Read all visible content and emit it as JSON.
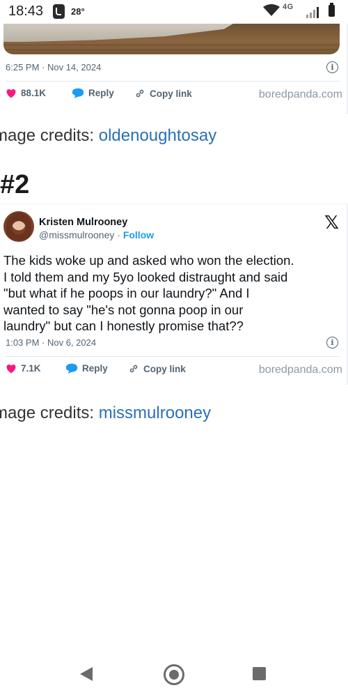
{
  "status_bar": {
    "time": "18:43",
    "temperature": "28°",
    "network": "4G",
    "icons": [
      "phone-call-icon",
      "wifi-icon",
      "cell-signal-icon",
      "battery-icon"
    ]
  },
  "tweet1": {
    "timestamp": "6:25 PM · Nov 14, 2024",
    "likes": "88.1K",
    "reply_label": "Reply",
    "copy_link_label": "Copy link",
    "source": "boredpanda.com"
  },
  "credits1": {
    "prefix": "mage credits: ",
    "link": "oldenoughtosay"
  },
  "item2": {
    "number": "#2"
  },
  "tweet2": {
    "author_name": "Kristen Mulrooney",
    "handle": "@missmulrooney",
    "separator": " · ",
    "follow_label": "Follow",
    "lines": [
      "The kids woke up and asked who won the election.",
      "I told them and my 5yo looked distraught and said",
      "\"but what if he poops in our laundry?\" And I",
      "wanted to say \"he's not gonna poop in our",
      "laundry\" but can I honestly promise that??"
    ],
    "timestamp": "1:03 PM · Nov 6, 2024",
    "likes": "7.1K",
    "reply_label": "Reply",
    "copy_link_label": "Copy link",
    "source": "boredpanda.com"
  },
  "credits2": {
    "prefix": "mage credits: ",
    "link": "missmulrooney"
  },
  "colors": {
    "heart": "#f91880",
    "reply_bubble": "#1d9bf0",
    "link": "#2a6fb8",
    "follow": "#1d9bf0"
  }
}
